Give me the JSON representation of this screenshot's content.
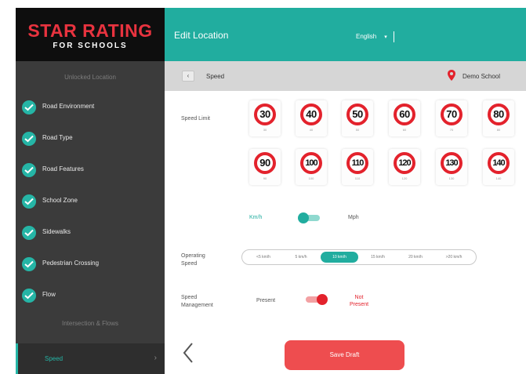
{
  "logo": {
    "line1": "STAR RATING",
    "line2": "FOR SCHOOLS"
  },
  "sidebar": {
    "section_top": "Unlocked Location",
    "items": [
      {
        "label": "Road Environment"
      },
      {
        "label": "Road Type"
      },
      {
        "label": "Road Features"
      },
      {
        "label": "School Zone"
      },
      {
        "label": "Sidewalks"
      },
      {
        "label": "Pedestrian Crossing"
      },
      {
        "label": "Flow"
      }
    ],
    "section_bottom": "Intersection & Flows",
    "active_item": {
      "label": "Speed"
    }
  },
  "header": {
    "title": "Edit Location",
    "language": "English"
  },
  "subheader": {
    "title": "Speed",
    "location": "Demo School"
  },
  "speed_limit": {
    "label": "Speed Limit",
    "signs": [
      {
        "value": "30",
        "caption": "30"
      },
      {
        "value": "40",
        "caption": "40"
      },
      {
        "value": "50",
        "caption": "50"
      },
      {
        "value": "60",
        "caption": "60"
      },
      {
        "value": "70",
        "caption": "70"
      },
      {
        "value": "80",
        "caption": "80"
      },
      {
        "value": "90",
        "caption": "90"
      },
      {
        "value": "100",
        "caption": "100"
      },
      {
        "value": "110",
        "caption": "110"
      },
      {
        "value": "120",
        "caption": "120"
      },
      {
        "value": "130",
        "caption": "130"
      },
      {
        "value": "140",
        "caption": "140"
      }
    ]
  },
  "units": {
    "left": "Km/h",
    "right": "Mph"
  },
  "operating_speed": {
    "label": "Operating Speed",
    "options": [
      "<5 km/h",
      "5 km/h",
      "10 km/h",
      "15 km/h",
      "20 km/h",
      ">20 km/h"
    ],
    "selected_index": 2
  },
  "speed_management": {
    "label": "Speed Management",
    "left": "Present",
    "right": "Not Present"
  },
  "save_label": "Save Draft",
  "colors": {
    "teal": "#21ad9f",
    "red": "#e3222c",
    "button_red": "#ee4d4f",
    "sidebar": "#3b3b3b"
  }
}
